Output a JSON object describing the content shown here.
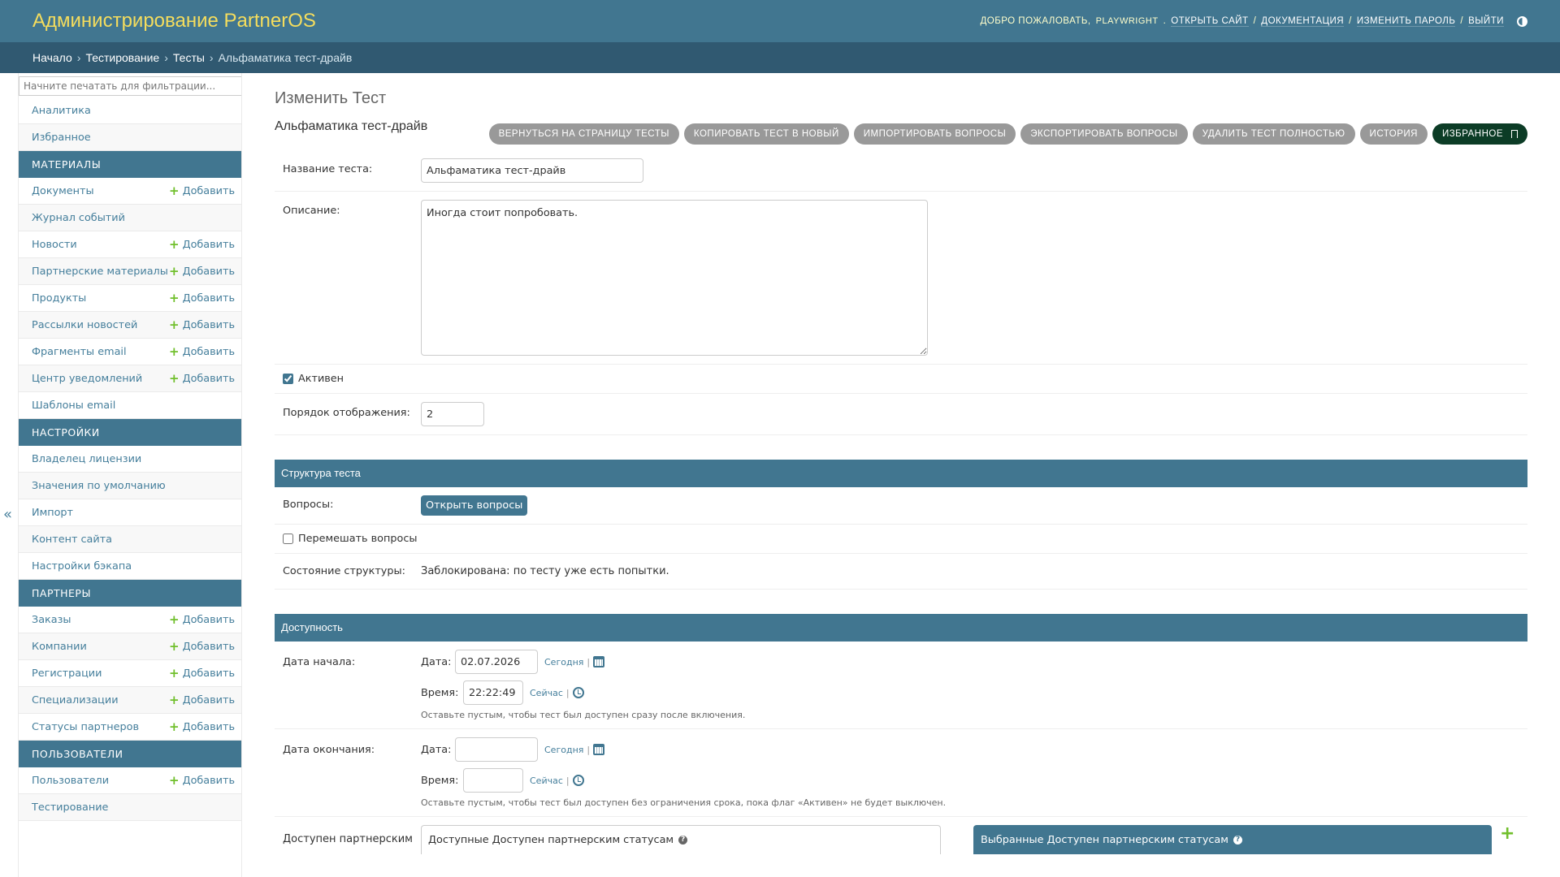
{
  "header": {
    "title": "Администрирование PartnerOS",
    "welcome": "Добро пожаловать,",
    "username": "playwright",
    "links": [
      "Открыть сайт",
      "Документация",
      "Изменить пароль",
      "Выйти"
    ]
  },
  "breadcrumbs": [
    "Начало",
    "Тестирование",
    "Тесты",
    "Альфаматика тест-драйв"
  ],
  "sidebar": {
    "filter_placeholder": "Начните печатать для фильтрации...",
    "add_label": "Добавить",
    "toggle": "«",
    "top_items": [
      "Аналитика",
      "Избранное"
    ],
    "sections": [
      {
        "title": "Материалы",
        "items": [
          {
            "label": "Документы",
            "add": true
          },
          {
            "label": "Журнал событий",
            "add": false
          },
          {
            "label": "Новости",
            "add": true
          },
          {
            "label": "Партнерские материалы",
            "add": true
          },
          {
            "label": "Продукты",
            "add": true
          },
          {
            "label": "Рассылки новостей",
            "add": true
          },
          {
            "label": "Фрагменты email",
            "add": true
          },
          {
            "label": "Центр уведомлений",
            "add": true
          },
          {
            "label": "Шаблоны email",
            "add": false
          }
        ]
      },
      {
        "title": "Настройки",
        "items": [
          {
            "label": "Владелец лицензии",
            "add": false
          },
          {
            "label": "Значения по умолчанию",
            "add": false
          },
          {
            "label": "Импорт",
            "add": false
          },
          {
            "label": "Контент сайта",
            "add": false
          },
          {
            "label": "Настройки бэкапа",
            "add": false
          }
        ]
      },
      {
        "title": "Партнеры",
        "items": [
          {
            "label": "Заказы",
            "add": true
          },
          {
            "label": "Компании",
            "add": true
          },
          {
            "label": "Регистрации",
            "add": true
          },
          {
            "label": "Специализации",
            "add": true
          },
          {
            "label": "Статусы партнеров",
            "add": true
          }
        ]
      },
      {
        "title": "Пользователи",
        "items": [
          {
            "label": "Пользователи",
            "add": true
          },
          {
            "label": "Тестирование",
            "add": false
          }
        ]
      }
    ]
  },
  "content": {
    "page_title": "Изменить Тест",
    "object_name": "Альфаматика тест-драйв",
    "tools": [
      "Вернуться на страницу Тесты",
      "Копировать тест в новый",
      "Импортировать вопросы",
      "Экспортировать вопросы",
      "Удалить тест полностью",
      "История"
    ],
    "favorite": "Избранное",
    "fields": {
      "name_label": "Название теста:",
      "name_value": "Альфаматика тест-драйв",
      "desc_label": "Описание:",
      "desc_value": "Иногда стоит попробовать.",
      "active_label": "Активен",
      "order_label": "Порядок отображения:",
      "order_value": "2"
    },
    "structure": {
      "title": "Структура теста",
      "questions_label": "Вопросы:",
      "questions_button": "Открыть вопросы",
      "shuffle_label": "Перемешать вопросы",
      "state_label": "Состояние структуры:",
      "state_value": "Заблокирована: по тесту уже есть попытки."
    },
    "availability": {
      "title": "Доступность",
      "date_label": "Дата:",
      "time_label": "Время:",
      "today": "Сегодня",
      "now": "Сейчас",
      "start_label": "Дата начала:",
      "start_date": "02.07.2026",
      "start_time": "22:22:49",
      "start_help": "Оставьте пустым, чтобы тест был доступен сразу после включения.",
      "end_label": "Дата окончания:",
      "end_date": "",
      "end_time": "",
      "end_help": "Оставьте пустым, чтобы тест был доступен без ограничения срока, пока флаг «Активен» не будет выключен.",
      "partner_label": "Доступен партнерским",
      "available_title": "Доступные Доступен партнерским статусам",
      "chosen_title": "Выбранные Доступен партнерским статусам"
    }
  },
  "colors": {
    "header_bg": "#417690",
    "breadcrumbs_bg": "#305971",
    "brand_text": "#f5dd5d",
    "link": "#447e9b",
    "add_plus": "#70bf2b",
    "favorite_bg": "#0c3c26"
  }
}
